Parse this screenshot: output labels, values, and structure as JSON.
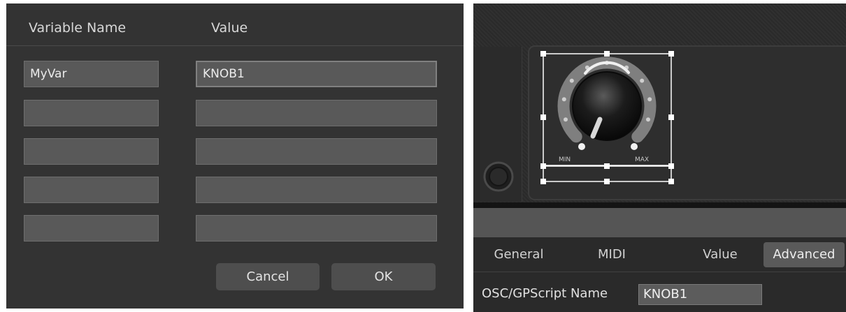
{
  "variable_dialog": {
    "headers": {
      "name": "Variable Name",
      "value": "Value"
    },
    "rows": [
      {
        "name": "MyVar",
        "value": "KNOB1"
      },
      {
        "name": "",
        "value": ""
      },
      {
        "name": "",
        "value": ""
      },
      {
        "name": "",
        "value": ""
      },
      {
        "name": "",
        "value": ""
      }
    ],
    "buttons": {
      "cancel": "Cancel",
      "ok": "OK"
    }
  },
  "widget_editor": {
    "knob": {
      "min_label": "MIN",
      "max_label": "MAX",
      "level": 0.12
    },
    "tabs": [
      {
        "label": "General",
        "active": false
      },
      {
        "label": "MIDI",
        "active": false
      },
      {
        "label": "Value",
        "active": false
      },
      {
        "label": "Advanced",
        "active": true
      }
    ],
    "osc_name": {
      "label": "OSC/GPScript Name",
      "value": "KNOB1"
    }
  }
}
